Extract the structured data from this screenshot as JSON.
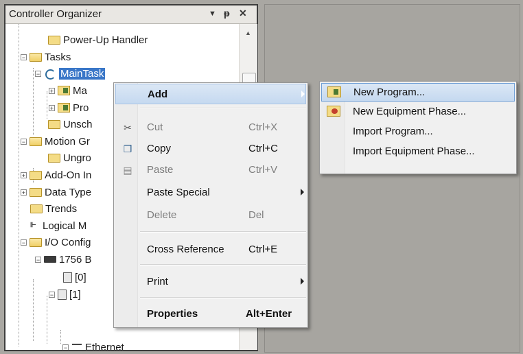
{
  "panel": {
    "title": "Controller Organizer",
    "dropdown_glyph": "▼",
    "pin_glyph": "ᵽ",
    "close_glyph": "✕"
  },
  "tree": [
    {
      "label": "Power-Up Handler",
      "icon": "folder-icon"
    },
    {
      "label": "Tasks",
      "icon": "folder-open-icon",
      "expander": "−"
    },
    {
      "label": "MainTask",
      "icon": "task-icon",
      "expander": "−",
      "selected": true
    },
    {
      "label": "Ma",
      "icon": "program-icon",
      "expander": "+"
    },
    {
      "label": "Pro",
      "icon": "program-icon",
      "expander": "+"
    },
    {
      "label": "Unsch",
      "icon": "folder-icon"
    },
    {
      "label": "Motion Gr",
      "icon": "folder-open-icon",
      "expander": "−"
    },
    {
      "label": "Ungro",
      "icon": "folder-icon"
    },
    {
      "label": "Add-On In",
      "icon": "folder-icon",
      "expander": "+"
    },
    {
      "label": "Data Type",
      "icon": "folder-icon",
      "expander": "+"
    },
    {
      "label": "Trends",
      "icon": "folder-icon"
    },
    {
      "label": "Logical M",
      "icon": "logical-model-icon"
    },
    {
      "label": "I/O Config",
      "icon": "folder-open-icon",
      "expander": "−"
    },
    {
      "label": "1756 B",
      "icon": "module-icon",
      "expander": "−"
    },
    {
      "label": "[0]",
      "icon": "slot-icon"
    },
    {
      "label": "[1]",
      "icon": "slot-icon",
      "expander": "−"
    },
    {
      "label": "Ethernet",
      "icon": "network-icon",
      "expander": "−"
    }
  ],
  "context_menu": {
    "items": [
      {
        "label": "Add",
        "shortcut": "",
        "bold": true,
        "submenu": true,
        "highlighted": true,
        "icon": ""
      },
      {
        "label": "Cut",
        "shortcut": "Ctrl+X",
        "disabled": true,
        "icon": "scissors-icon"
      },
      {
        "label": "Copy",
        "shortcut": "Ctrl+C",
        "icon": "copy-icon"
      },
      {
        "label": "Paste",
        "shortcut": "Ctrl+V",
        "disabled": true,
        "icon": "paste-icon"
      },
      {
        "label": "Paste Special",
        "shortcut": "",
        "submenu": true
      },
      {
        "label": "Delete",
        "shortcut": "Del",
        "disabled": true
      },
      {
        "label": "Cross Reference",
        "shortcut": "Ctrl+E"
      },
      {
        "label": "Print",
        "shortcut": "",
        "submenu": true
      },
      {
        "label": "Properties",
        "shortcut": "Alt+Enter",
        "bold": true
      }
    ]
  },
  "add_submenu": {
    "items": [
      {
        "label": "New Program...",
        "icon": "new-program-icon",
        "highlighted": true
      },
      {
        "label": "New Equipment Phase...",
        "icon": "new-equipment-phase-icon"
      },
      {
        "label": "Import Program...",
        "icon": ""
      },
      {
        "label": "Import Equipment Phase...",
        "icon": ""
      }
    ]
  },
  "colors": {
    "selection": "#3a77c8",
    "menu_highlight": "#c5d9f0",
    "workspace": "#a7a5a0"
  }
}
